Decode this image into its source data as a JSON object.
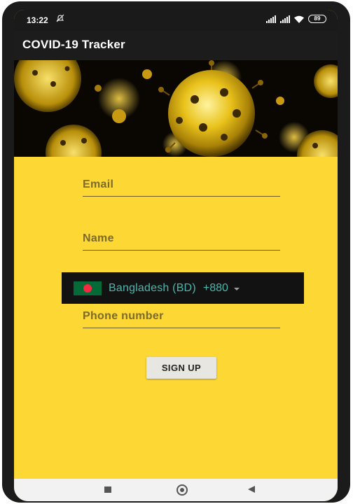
{
  "status_bar": {
    "time": "13:22",
    "mute_icon": "bell-off-icon",
    "battery": "89"
  },
  "app_bar": {
    "title": "COVID-19 Tracker"
  },
  "hero": {
    "image": "coronavirus-particles-image"
  },
  "form": {
    "email": {
      "placeholder": "Email",
      "value": ""
    },
    "name": {
      "placeholder": "Name",
      "value": ""
    },
    "country": {
      "label": "Bangladesh (BD)",
      "dial_code": "+880",
      "flag": "bangladesh-flag-icon"
    },
    "phone": {
      "placeholder": "Phone number",
      "value": ""
    },
    "signup_label": "SIGN UP"
  },
  "nav_bar": {
    "recent": "square-icon",
    "home": "circle-icon",
    "back": "triangle-back-icon"
  },
  "colors": {
    "screen_bg": "#fdd835",
    "app_bar": "#1c1c1c",
    "country_picker_bg": "#121212",
    "country_text": "#4db6ac",
    "button_bg": "#e8e6e1"
  }
}
